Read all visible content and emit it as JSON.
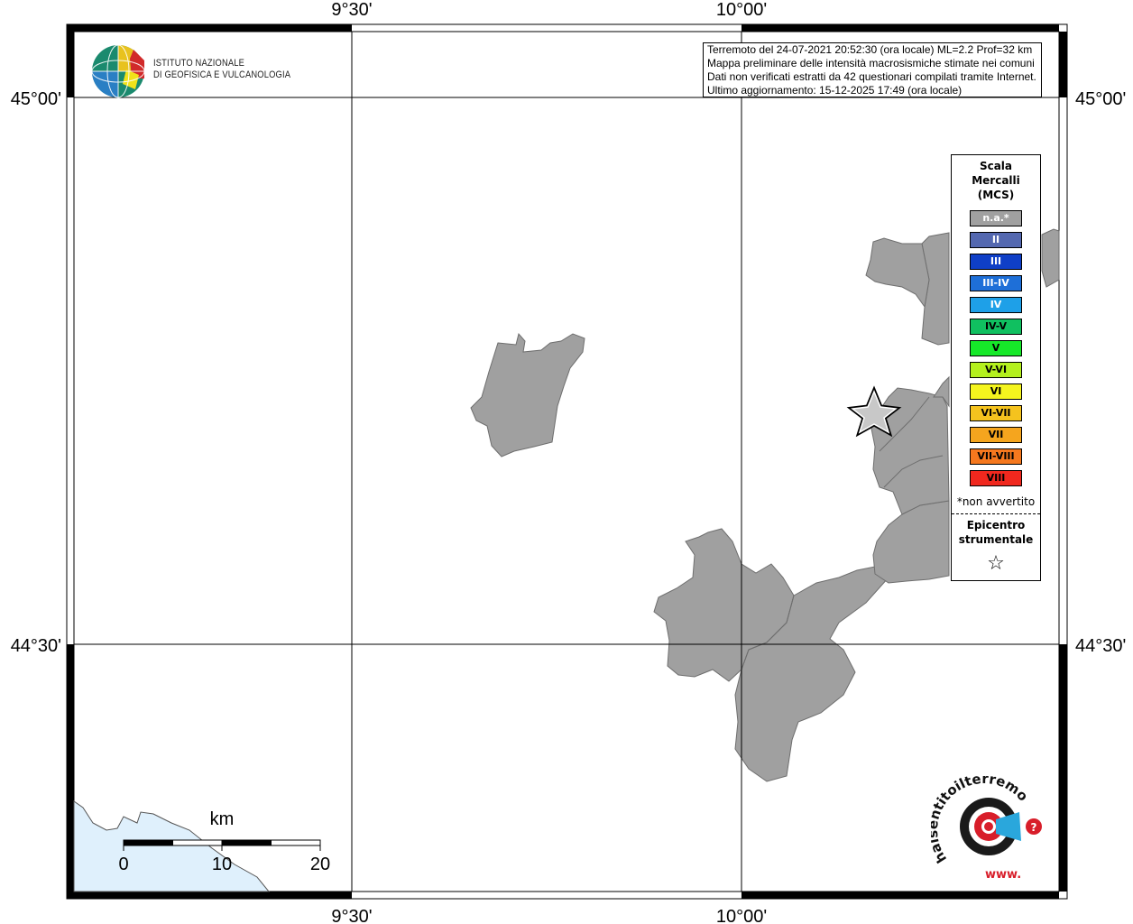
{
  "axes": {
    "top": [
      "9°30'",
      "10°00'"
    ],
    "bottom": [
      "9°30'",
      "10°00'"
    ],
    "left": [
      "45°00'",
      "44°30'"
    ],
    "right": [
      "45°00'",
      "44°30'"
    ]
  },
  "info": {
    "line1": "Terremoto del 24-07-2021 20:52:30 (ora locale) ML=2.2 Prof=32 km",
    "line2": "Mappa preliminare delle intensità macrosismiche stimate nei comuni",
    "line3": "Dati non verificati estratti da 42 questionari compilati tramite Internet.",
    "line4": "Ultimo aggiornamento: 15-12-2025 17:49 (ora locale)"
  },
  "institute": {
    "line1": "ISTITUTO NAZIONALE",
    "line2": "DI GEOFISICA E VULCANOLOGIA"
  },
  "legend": {
    "title1": "Scala",
    "title2": "Mercalli",
    "title3": "(MCS)",
    "items": [
      {
        "label": "n.a.*",
        "color": "#a0a0a0"
      },
      {
        "label": "II",
        "color": "#5468b0"
      },
      {
        "label": "III",
        "color": "#0f3fc7"
      },
      {
        "label": "III-IV",
        "color": "#1e6fd8"
      },
      {
        "label": "IV",
        "color": "#1ea0e8"
      },
      {
        "label": "IV-V",
        "color": "#10c060"
      },
      {
        "label": "V",
        "color": "#16e829"
      },
      {
        "label": "V-VI",
        "color": "#b4f01e"
      },
      {
        "label": "VI",
        "color": "#f5f51e"
      },
      {
        "label": "VI-VII",
        "color": "#f5c31e"
      },
      {
        "label": "VII",
        "color": "#f5a51e"
      },
      {
        "label": "VII-VIII",
        "color": "#f5781e"
      },
      {
        "label": "VIII",
        "color": "#f0281e"
      }
    ],
    "note": "*non avvertito",
    "epicentre1": "Epicentro",
    "epicentre2": "strumentale"
  },
  "scalebar": {
    "unit": "km",
    "ticks": [
      "0",
      "10",
      "20"
    ]
  },
  "colors": {
    "municipality_fill": "#a0a0a0",
    "sea": "#dff0fc"
  },
  "brand": {
    "site": "haisentitoilterremoto.it",
    "www": "www."
  }
}
